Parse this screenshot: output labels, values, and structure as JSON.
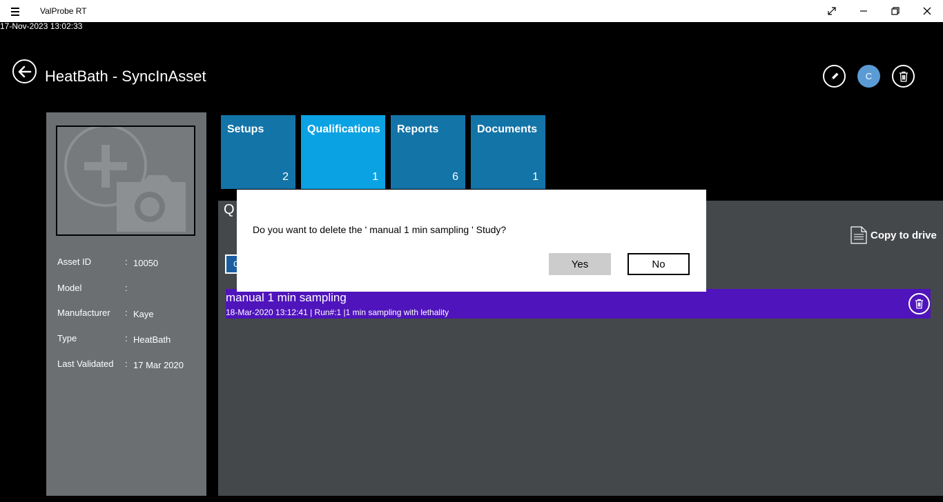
{
  "titlebar": {
    "app_title": "ValProbe RT",
    "icons": {
      "menu": "hamburger-icon",
      "fullscreen": "expand-icon",
      "minimize": "minimize-icon",
      "restore": "restore-icon",
      "close": "close-icon"
    }
  },
  "timestamp": "17-Nov-2023 13:02:33",
  "header": {
    "title": "HeatBath - SyncInAsset",
    "avatar_letter": "C",
    "icons": {
      "back": "back-arrow-icon",
      "edit": "pencil-icon",
      "delete": "trash-icon"
    }
  },
  "asset": {
    "photo_icon": "add-photo-icon",
    "properties": [
      {
        "label": "Asset ID",
        "value": "10050"
      },
      {
        "label": "Model",
        "value": ""
      },
      {
        "label": "Manufacturer",
        "value": "Kaye"
      },
      {
        "label": "Type",
        "value": "HeatBath"
      },
      {
        "label": "Last Validated",
        "value": "17 Mar 2020"
      }
    ]
  },
  "tiles": [
    {
      "label": "Setups",
      "count": "2",
      "active": false
    },
    {
      "label": "Qualifications",
      "count": "1",
      "active": true
    },
    {
      "label": "Reports",
      "count": "6",
      "active": false
    },
    {
      "label": "Documents",
      "count": "1",
      "active": false
    }
  ],
  "main": {
    "heading_visible": "Q",
    "copy_to_drive": "Copy to drive",
    "hidden_button_visible": "C",
    "study": {
      "name": "manual 1 min sampling",
      "meta": "18-Mar-2020 13:12:41 | Run#:1 |1 min sampling with lethality",
      "highlight_color": "#4f14bb"
    }
  },
  "dialog": {
    "message": "Do you want to delete the ' manual 1 min sampling ' Study?",
    "yes_label": "Yes",
    "no_label": "No"
  },
  "colors": {
    "tile": "#1374a8",
    "tile_active": "#0ba2e3",
    "left_panel": "#6b6f72",
    "main_panel": "#45484b",
    "avatar": "#5b9bd5"
  }
}
